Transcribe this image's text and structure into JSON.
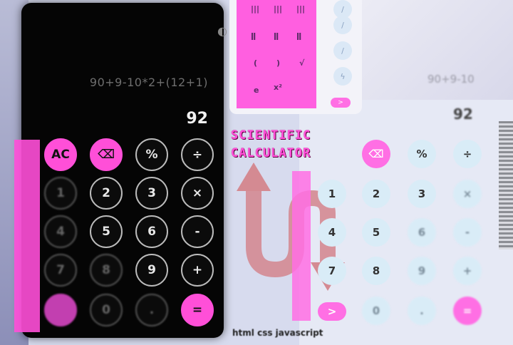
{
  "dark": {
    "expression": "90+9-10*2+(12+1)",
    "result": "92",
    "keys": [
      {
        "l": "AC",
        "t": "pink"
      },
      {
        "l": "⌫",
        "t": "pink"
      },
      {
        "l": "%",
        "t": "n"
      },
      {
        "l": "÷",
        "t": "n"
      },
      {
        "l": "1",
        "t": "dim"
      },
      {
        "l": "2",
        "t": "n"
      },
      {
        "l": "3",
        "t": "n"
      },
      {
        "l": "×",
        "t": "n"
      },
      {
        "l": "4",
        "t": "dim"
      },
      {
        "l": "5",
        "t": "n"
      },
      {
        "l": "6",
        "t": "n"
      },
      {
        "l": "-",
        "t": "n"
      },
      {
        "l": "7",
        "t": "dim"
      },
      {
        "l": "8",
        "t": "dim"
      },
      {
        "l": "9",
        "t": "n"
      },
      {
        "l": "+",
        "t": "n"
      },
      {
        "l": "",
        "t": "pinkdim"
      },
      {
        "l": "0",
        "t": "dim"
      },
      {
        "l": ".",
        "t": "dim"
      },
      {
        "l": "=",
        "t": "pink"
      }
    ]
  },
  "scientific": {
    "keys": [
      "(",
      ")",
      "√",
      "e",
      "x²"
    ],
    "next_label": ">"
  },
  "title": {
    "line1": "SCIENTIFIC",
    "line2": "CALCULATOR"
  },
  "light": {
    "expression": "90+9-10",
    "result": "92",
    "keys": [
      {
        "l": "⌫",
        "t": "pink"
      },
      {
        "l": "%",
        "t": "n"
      },
      {
        "l": "÷",
        "t": "n"
      },
      {
        "l": "1",
        "t": "n"
      },
      {
        "l": "2",
        "t": "n"
      },
      {
        "l": "3",
        "t": "n"
      },
      {
        "l": "×",
        "t": "dim"
      },
      {
        "l": "4",
        "t": "n"
      },
      {
        "l": "5",
        "t": "n"
      },
      {
        "l": "6",
        "t": "dim"
      },
      {
        "l": "-",
        "t": "dim"
      },
      {
        "l": "7",
        "t": "n"
      },
      {
        "l": "8",
        "t": "n"
      },
      {
        "l": "9",
        "t": "dim"
      },
      {
        "l": "+",
        "t": "dim"
      },
      {
        "l": ">",
        "t": "pinkpill"
      },
      {
        "l": "0",
        "t": "dim"
      },
      {
        "l": ".",
        "t": "dim"
      },
      {
        "l": "=",
        "t": "pinkdim"
      }
    ]
  },
  "footer": "html css javascript",
  "colors": {
    "accent": "#ff4fd8",
    "dark_bg": "#050505",
    "light_key": "#d9ecf7"
  }
}
